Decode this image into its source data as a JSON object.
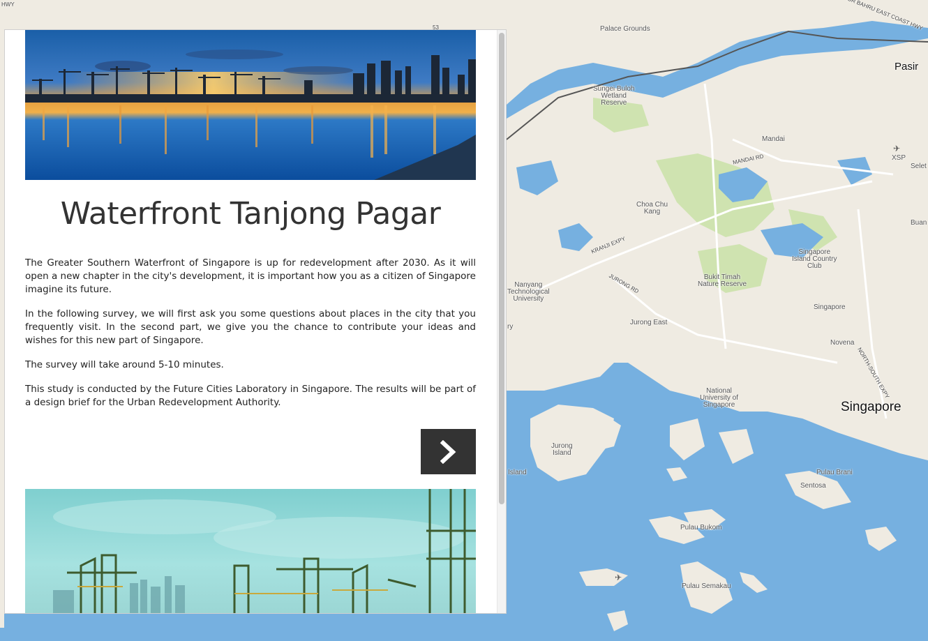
{
  "map": {
    "labels": {
      "palace_grounds": "Palace Grounds",
      "sungei_buloh": "Sungei Buloh\nWetland\nReserve",
      "mandai": "Mandai",
      "mandai_rd": "MANDAI RD",
      "xsp": "XSP",
      "choa_chu_kang": "Choa Chu\nKang",
      "kranji_expy": "KRANJI EXPY",
      "jurong_rd": "JURONG RD",
      "nanyang": "Nanyang\nTechnological\nUniversity",
      "bukit_timah": "Bukit Timah\nNature Reserve",
      "singapore_island_cc": "Singapore\nIsland Country\nClub",
      "singapore_small": "Singapore",
      "jurong_east": "Jurong East",
      "novena": "Novena",
      "nus": "National\nUniversity of\nSingapore",
      "singapore_big": "Singapore",
      "jurong_island": "Jurong\nIsland",
      "island": "Island",
      "pulau_brani": "Pulau Brani",
      "sentosa": "Sentosa",
      "pulau_bukom": "Pulau Bukom",
      "pulau_semakau": "Pulau Semakau",
      "pasir": "Pasir",
      "seletar": "Selet",
      "buan": "Buan",
      "johor_bahru": "JOHOR BAHRU EAST COAST HWY",
      "north_south_expy": "NORTH-SOUTH EXPY",
      "hwy": "HWY",
      "ry": "ry",
      "road_53": "53"
    }
  },
  "panel": {
    "title": "Waterfront Tanjong Pagar",
    "paragraphs": [
      "The Greater Southern Waterfront of Singapore is up for redevelopment after 2030. As it will open a new chapter in the city's development, it is important how you as a citizen of Singapore imagine its future.",
      "In the following survey, we will first ask you some questions about places in the city that you frequently visit. In the second part, we give you the chance to contribute your ideas and wishes for this new part of Singapore.",
      "The survey will take around 5-10 minutes.",
      "This study is conducted by the Future Cities Laboratory in Singapore. The results will be part of a design brief for the Urban Redevelopment Authority."
    ],
    "next_icon": "chevron-right-icon"
  },
  "colors": {
    "sea": "#76b0e0",
    "land": "#efebe2",
    "park": "#cfe3b0",
    "button": "#333333"
  }
}
